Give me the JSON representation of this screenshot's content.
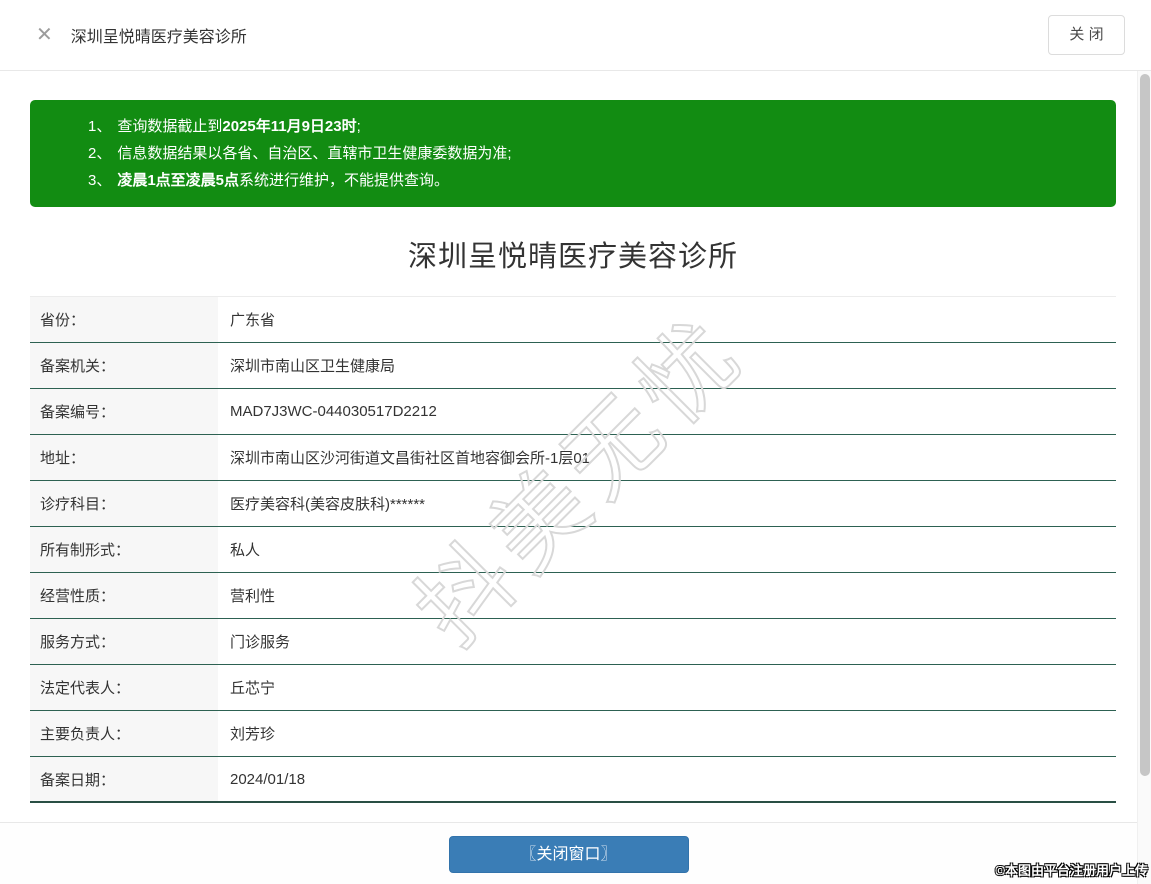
{
  "window": {
    "close_icon": "✕",
    "title": "深圳呈悦晴医疗美容诊所",
    "close_button_label": "关 闭"
  },
  "notice": {
    "items": [
      {
        "num": "1、",
        "pre": "查询数据截止到",
        "bold": "2025年11月9日23时",
        "post": ";"
      },
      {
        "num": "2、",
        "pre": "信息数据结果以各省、自治区、直辖市卫生健康委数据为准;",
        "bold": "",
        "post": ""
      },
      {
        "num": "3、",
        "pre": "",
        "bold": "凌晨1点至凌晨5点",
        "post": "系统进行维护，不能提供查询。"
      }
    ]
  },
  "detail": {
    "title": "深圳呈悦晴医疗美容诊所",
    "rows": [
      {
        "label": "省份：",
        "value": "广东省"
      },
      {
        "label": "备案机关：",
        "value": "深圳市南山区卫生健康局"
      },
      {
        "label": "备案编号：",
        "value": "MAD7J3WC-044030517D2212"
      },
      {
        "label": "地址：",
        "value": "深圳市南山区沙河街道文昌街社区首地容御会所-1层01"
      },
      {
        "label": "诊疗科目：",
        "value": "医疗美容科(美容皮肤科)******"
      },
      {
        "label": "所有制形式：",
        "value": "私人"
      },
      {
        "label": "经营性质：",
        "value": "营利性"
      },
      {
        "label": "服务方式：",
        "value": "门诊服务"
      },
      {
        "label": "法定代表人：",
        "value": "丘芯宁"
      },
      {
        "label": "主要负责人：",
        "value": "刘芳珍"
      },
      {
        "label": "备案日期：",
        "value": "2024/01/18"
      }
    ]
  },
  "footer": {
    "close_button_label": "〖关闭窗口〗"
  },
  "watermarks": {
    "center_text": "抖美无忧",
    "copyright_text": "©本图由平台注册用户上传"
  },
  "colors": {
    "notice_green": "#128c12",
    "button_blue": "#3a7db6",
    "row_divider_green": "#2d6152",
    "label_cell_bg": "#f7f7f7"
  }
}
